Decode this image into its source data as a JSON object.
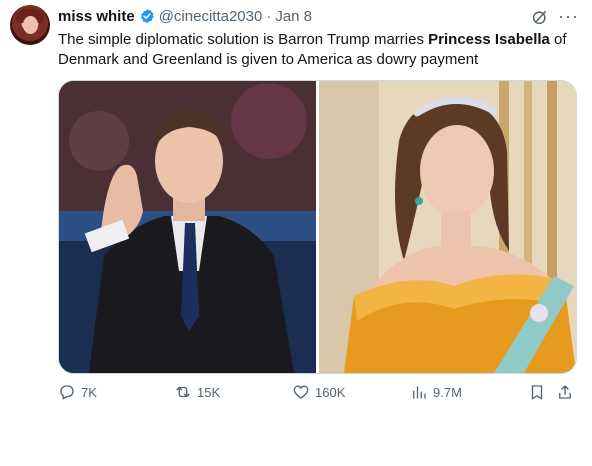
{
  "tweet": {
    "display_name": "miss white",
    "handle": "@cinecitta2030",
    "date": "Jan 8",
    "more_label": "···",
    "text_part1": "The simple diplomatic solution is Barron Trump marries ",
    "text_bold": "Princess Isabella",
    "text_part2": " of Denmark and Greenland is given to America as dowry payment"
  },
  "actions": {
    "replies": "7K",
    "reposts": "15K",
    "likes": "160K",
    "views": "9.7M"
  },
  "colors": {
    "text": "#0f1419",
    "muted": "#536471",
    "verified": "#1d9bf0",
    "border": "#cfd9de"
  }
}
